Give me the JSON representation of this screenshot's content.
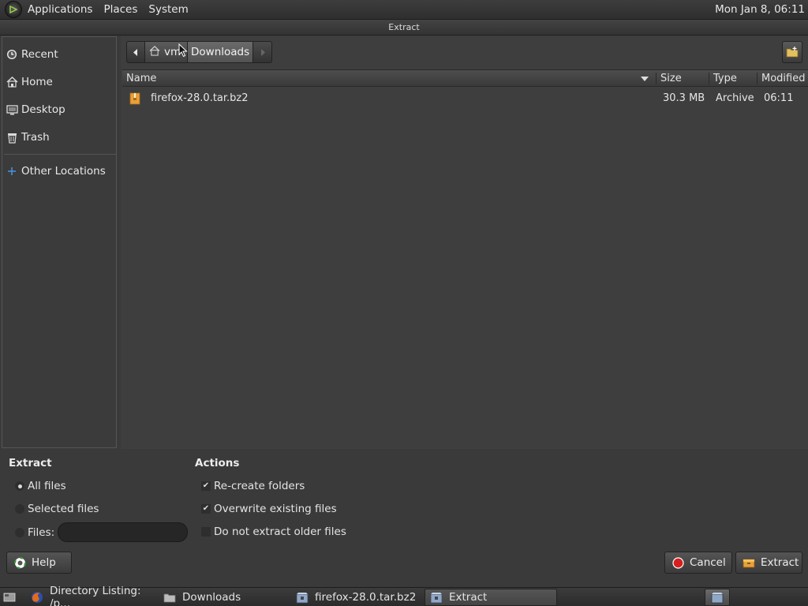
{
  "top_panel": {
    "menus": [
      "Applications",
      "Places",
      "System"
    ],
    "clock": "Mon Jan  8, 06:11",
    "logo_icon": "mate-menu-icon"
  },
  "window": {
    "title": "Extract"
  },
  "sidebar": {
    "items": [
      {
        "label": "Recent",
        "icon": "recent-icon"
      },
      {
        "label": "Home",
        "icon": "home-icon"
      },
      {
        "label": "Desktop",
        "icon": "desktop-icon"
      },
      {
        "label": "Trash",
        "icon": "trash-icon"
      },
      {
        "label": "Other Locations",
        "icon": "plus-icon"
      }
    ]
  },
  "pathbar": {
    "home_label": "vm",
    "current_label": "Downloads"
  },
  "columns": {
    "name": "Name",
    "size": "Size",
    "type": "Type",
    "modified": "Modified",
    "sort": "descending"
  },
  "files": [
    {
      "name": "firefox-28.0.tar.bz2",
      "size": "30.3 MB",
      "type": "Archive",
      "modified": "06:11"
    }
  ],
  "options": {
    "extract_heading": "Extract",
    "all_files": "All files",
    "selected_files": "Selected files",
    "files_label": "Files:",
    "files_value": "",
    "extract_selection": "all_files",
    "actions_heading": "Actions",
    "recreate_folders": "Re-create folders",
    "recreate_folders_checked": true,
    "overwrite": "Overwrite existing files",
    "overwrite_checked": true,
    "no_older": "Do not extract older files",
    "no_older_checked": false
  },
  "buttons": {
    "help": "Help",
    "cancel": "Cancel",
    "extract": "Extract"
  },
  "taskbar": {
    "tasks": [
      {
        "label": "Directory Listing: /p...",
        "icon": "firefox-icon",
        "active": false
      },
      {
        "label": "Downloads",
        "icon": "folder-icon",
        "active": false
      },
      {
        "label": "firefox-28.0.tar.bz2",
        "icon": "archive-manager-icon",
        "active": false
      },
      {
        "label": "Extract",
        "icon": "archive-manager-icon",
        "active": true
      }
    ]
  },
  "colors": {
    "accent_red": "#d62020",
    "folder_orange": "#e8a03a",
    "background": "#3a3a3a"
  }
}
